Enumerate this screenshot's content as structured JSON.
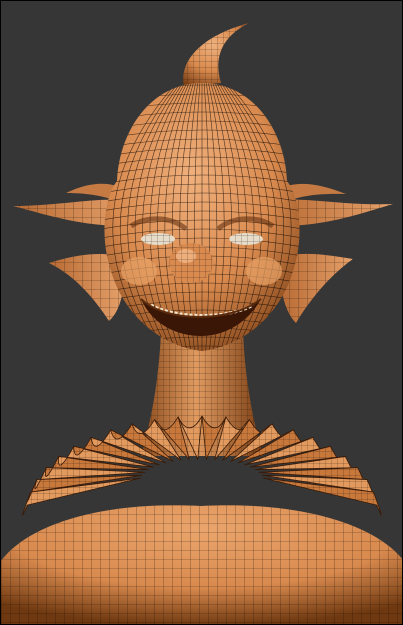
{
  "viewport": {
    "background_color": "#363636",
    "border_color": "#000000"
  },
  "model": {
    "subject": "clown bust",
    "shading": "wireframe-on-shaded",
    "base_color": "#d98a4e",
    "shadow_color": "#7a3e14",
    "highlight_color": "#f0b07c",
    "wire_color": "#1a0f08"
  }
}
